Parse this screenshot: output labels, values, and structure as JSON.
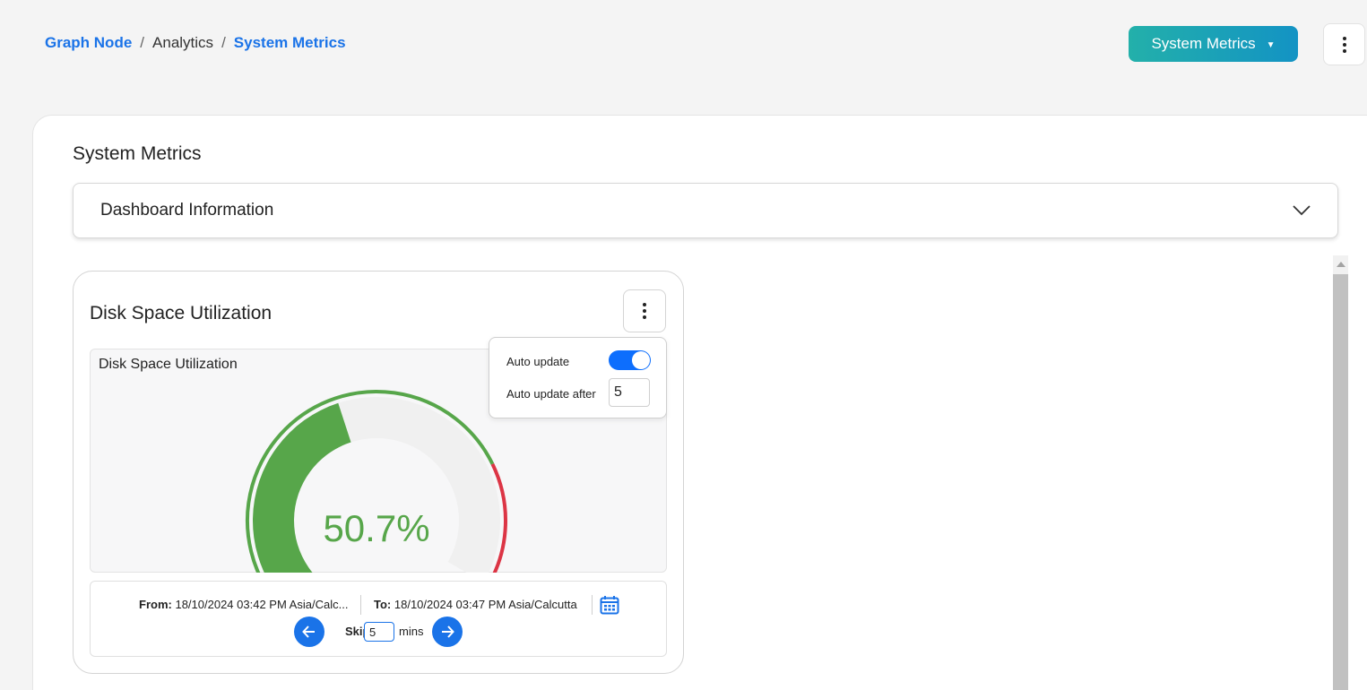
{
  "breadcrumb": {
    "items": [
      "Graph Node",
      "Analytics",
      "System Metrics"
    ],
    "separator": "/"
  },
  "header": {
    "dashboard_select": {
      "label": "System Metrics",
      "caret": "▼"
    },
    "menu_icon": "kebab-vertical-icon"
  },
  "page": {
    "title": "System Metrics"
  },
  "accordion": {
    "title": "Dashboard Information",
    "icon": "chevron-down-icon"
  },
  "widget": {
    "title": "Disk Space Utilization",
    "chart_title": "Disk Space Utilization",
    "auto_update": {
      "toggle_label": "Auto update",
      "enabled": true,
      "interval_label": "Auto update after",
      "interval_value": "5"
    },
    "range": {
      "from_label": "From:",
      "from_value": "18/10/2024 03:42 PM Asia/Calc...",
      "to_label": "To:",
      "to_value": "18/10/2024 03:47 PM Asia/Calcutta"
    },
    "skip": {
      "label": "Skip:",
      "value": "5",
      "unit": "mins"
    }
  },
  "colors": {
    "accent": "#1a73e8",
    "toggle_on": "#0d6efd",
    "gauge_fill": "#57a64a",
    "gauge_danger": "#dc3545",
    "gauge_track": "#f0f0f0"
  },
  "chart_data": {
    "type": "gauge",
    "title": "Disk Space Utilization",
    "value": 50.7,
    "display_value": "50.7%",
    "min": 0,
    "max": 100,
    "bands": [
      {
        "from": 0,
        "to": 80,
        "color": "#57a64a"
      },
      {
        "from": 80,
        "to": 100,
        "color": "#dc3545"
      }
    ]
  }
}
